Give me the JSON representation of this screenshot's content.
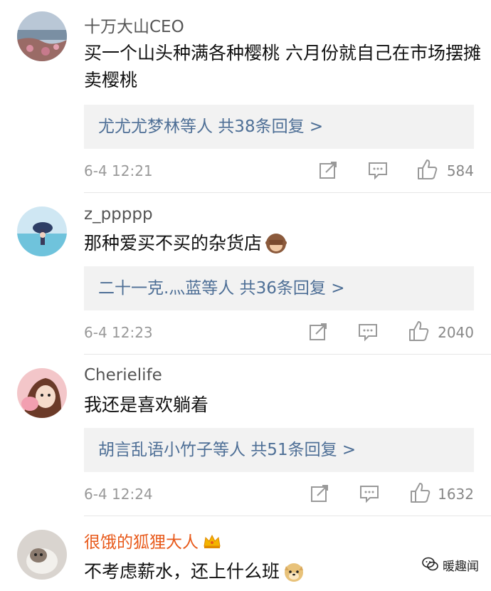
{
  "comments": [
    {
      "username": "十万大山CEO",
      "text": "买一个山头种满各种樱桃 六月份就自己在市场摆摊卖樱桃",
      "reply_summary": "尤尤尤梦林等人 共38条回复 >",
      "time": "6-4 12:21",
      "likes": "584"
    },
    {
      "username": "z_ppppp",
      "text": "那种爱买不买的杂货店",
      "reply_summary": "二十一克.灬蓝等人 共36条回复 >",
      "time": "6-4 12:23",
      "likes": "2040"
    },
    {
      "username": "Cherielife",
      "text": "我还是喜欢躺着",
      "reply_summary": "胡言乱语小竹子等人 共51条回复 >",
      "time": "6-4 12:24",
      "likes": "1632"
    },
    {
      "username": "很饿的狐狸大人",
      "text": "不考虑薪水，还上什么班"
    }
  ],
  "watermark": "暖趣闻",
  "colors": {
    "reply_link": "#4e6f96",
    "vip_username": "#e85a1b",
    "reply_bg": "#f2f2f2"
  }
}
